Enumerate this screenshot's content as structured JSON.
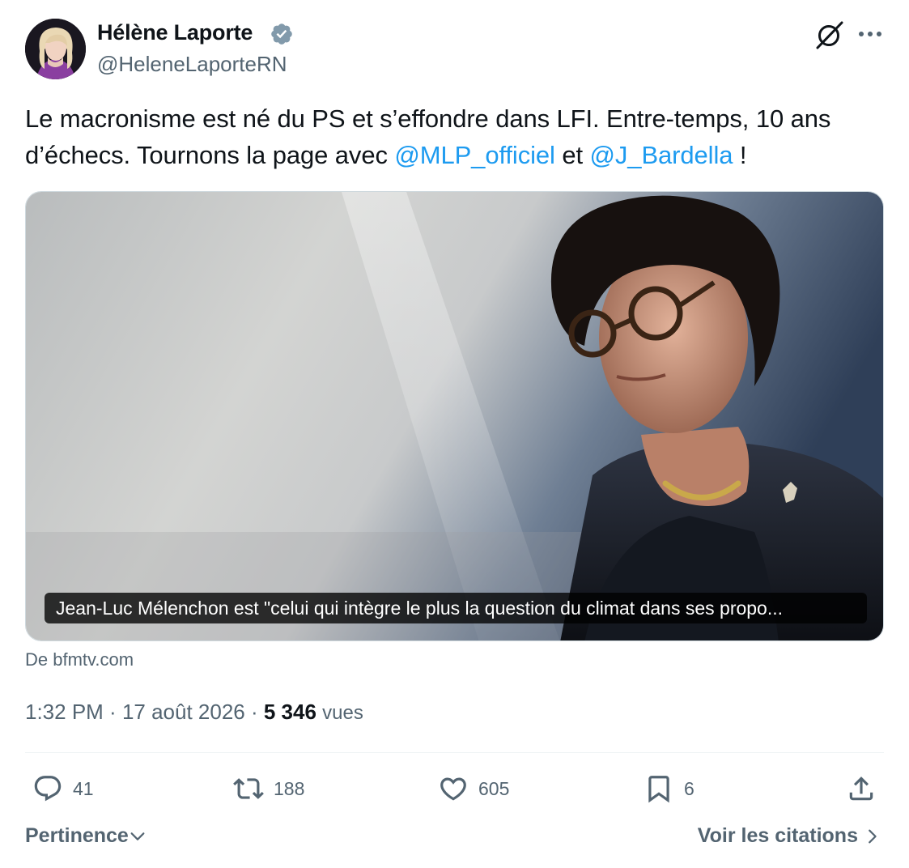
{
  "author": {
    "name": "Hélène Laporte",
    "handle": "@HeleneLaporteRN",
    "verified": true
  },
  "tweet": {
    "text_part1": "Le macronisme est né du PS et s’effondre dans LFI. Entre-temps, 10 ans d’échecs. Tournons la page avec ",
    "mention1": "@MLP_officiel",
    "text_part2": " et ",
    "mention2": "@J_Bardella",
    "text_part3": " !"
  },
  "media": {
    "caption": "Jean-Luc Mélenchon est \"celui qui intègre le plus la question du climat dans ses propo...",
    "source": "De bfmtv.com"
  },
  "meta": {
    "time": "1:32 PM",
    "separator": " · ",
    "date": "17 août 2026",
    "views_count": "5 346",
    "views_label": "vues"
  },
  "actions": {
    "replies": "41",
    "reposts": "188",
    "likes": "605",
    "bookmarks": "6"
  },
  "footer": {
    "sort_label": "Pertinence",
    "citations_label": "Voir les citations"
  },
  "colors": {
    "link": "#1d9bf0",
    "secondary_text": "#536471",
    "primary_text": "#0f1419",
    "verified_badge": "#829aab"
  },
  "icons": [
    "verified-badge-icon",
    "grok-icon",
    "more-icon",
    "reply-icon",
    "repost-icon",
    "like-icon",
    "bookmark-icon",
    "share-icon",
    "chevron-down-icon",
    "chevron-right-icon"
  ]
}
